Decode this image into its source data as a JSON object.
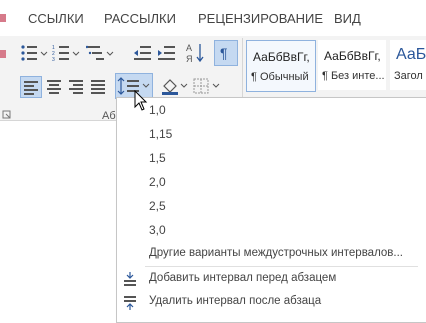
{
  "tabs": [
    "ССЫЛКИ",
    "РАССЫЛКИ",
    "РЕЦЕНЗИРОВАНИЕ",
    "ВИД"
  ],
  "styles": [
    {
      "sample": "АаБбВвГг,",
      "name": "¶ Обычный"
    },
    {
      "sample": "АаБбВвГг,",
      "name": "¶ Без инте..."
    },
    {
      "sample": "АаБбВ",
      "name": "Загол"
    }
  ],
  "group_label": "Аб",
  "line_spacing_menu": {
    "options": [
      "1,0",
      "1,15",
      "1,5",
      "2,0",
      "2,5",
      "3,0"
    ],
    "more_options": "Другие варианты междустрочных интервалов...",
    "add_before": "Добавить интервал перед абзацем",
    "remove_after": "Удалить интервал после абзаца"
  },
  "colors": {
    "accent": "#2b579a",
    "selected_bg": "#c5d9f1",
    "menu_text": "#444444"
  }
}
